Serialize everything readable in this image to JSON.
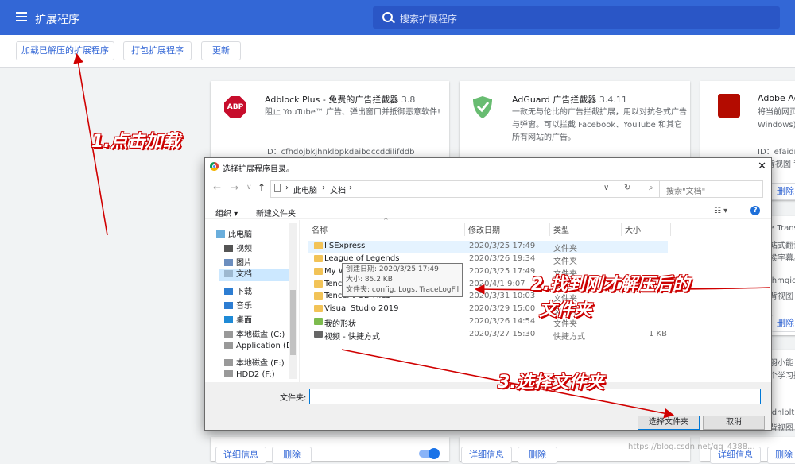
{
  "header": {
    "title": "扩展程序",
    "search_placeholder": "搜索扩展程序"
  },
  "toolbar": {
    "load_unpacked": "加载已解压的扩展程序",
    "pack": "打包扩展程序",
    "update": "更新"
  },
  "cards": [
    {
      "title": "Adblock Plus - 免费的广告拦截器",
      "version": "3.8",
      "description": "阻止 YouTube™ 广告、弹出窗口并抵御恶意软件!",
      "id": "ID：cfhdojbkjhnklbpkdaibdccddilifddb",
      "icon_label": "ABP",
      "details": "详细信息",
      "remove": "删除"
    },
    {
      "title": "AdGuard 广告拦截器",
      "version": "3.4.11",
      "description": "一款无与伦比的广告拦截扩展，用以对抗各式广告与弹窗。可以拦截 Facebook、YouTube 和其它所有网站的广告。",
      "details": "详细信息",
      "remove": "删除"
    },
    {
      "title": "Adobe Acr",
      "description": "将当前网页 Windows)",
      "id": "ID：efaidn",
      "extra": "背视图 背",
      "remove": "删除",
      "details": "详细信息"
    }
  ],
  "side_fragments": {
    "t1": "e Trans",
    "t2": "站式翻译",
    "t3": "侯字幕。",
    "t4": "ihmgic",
    "t5": "背视图 p",
    "t6": "删除",
    "t7": "羽小能",
    "t8": "个学习摄",
    "t9": "idnlblt",
    "t10": "背视图 背"
  },
  "dialog": {
    "title": "选择扩展程序目录。",
    "path": [
      "此电脑",
      "文档"
    ],
    "search_placeholder": "搜索\"文档\"",
    "organize": "组织 ▾",
    "new_folder": "新建文件夹",
    "nav": [
      "此电脑",
      "视频",
      "图片",
      "文档",
      "下载",
      "音乐",
      "桌面",
      "本地磁盘 (C:)",
      "Application (D:",
      "本地磁盘 (E:)",
      "HDD2 (F:)"
    ],
    "columns": [
      "名称",
      "修改日期",
      "类型",
      "大小"
    ],
    "files": [
      {
        "name": "IISExpress",
        "date": "2020/3/25 17:49",
        "type": "文件夹",
        "size": ""
      },
      {
        "name": "League of Legends",
        "date": "2020/3/26 19:34",
        "type": "文件夹",
        "size": ""
      },
      {
        "name": "My Web Sites",
        "date": "2020/3/25 17:49",
        "type": "文件夹",
        "size": ""
      },
      {
        "name": "Tencent Files",
        "date": "2020/4/1 9:07",
        "type": "文件夹",
        "size": ""
      },
      {
        "name": "Tencent OD Files",
        "date": "2020/3/31 10:03",
        "type": "文件夹",
        "size": ""
      },
      {
        "name": "Visual Studio 2019",
        "date": "2020/3/29 15:00",
        "type": "文件夹",
        "size": ""
      },
      {
        "name": "我的形状",
        "date": "2020/3/26 14:54",
        "type": "文件夹",
        "size": ""
      },
      {
        "name": "视频 - 快捷方式",
        "date": "2020/3/27 15:30",
        "type": "快捷方式",
        "size": "1 KB"
      }
    ],
    "tooltip": [
      "创建日期: 2020/3/25 17:49",
      "大小: 85.2 KB",
      "文件夹: config, Logs, TraceLogFil"
    ],
    "folder_label": "文件夹:",
    "select_btn": "选择文件夹",
    "cancel_btn": "取消"
  },
  "annotations": {
    "step1": "1.点击加载",
    "step2": "2.找到刚才解压后的",
    "step2b": "文件夹",
    "step3": "3.选择文件夹"
  },
  "bottom": {
    "details": "详细信息",
    "remove": "删除"
  },
  "watermark": "https://blog.csdn.net/qq_4388...",
  "colors": {
    "brand": "#3367d6",
    "annotation": "#cc0000"
  }
}
